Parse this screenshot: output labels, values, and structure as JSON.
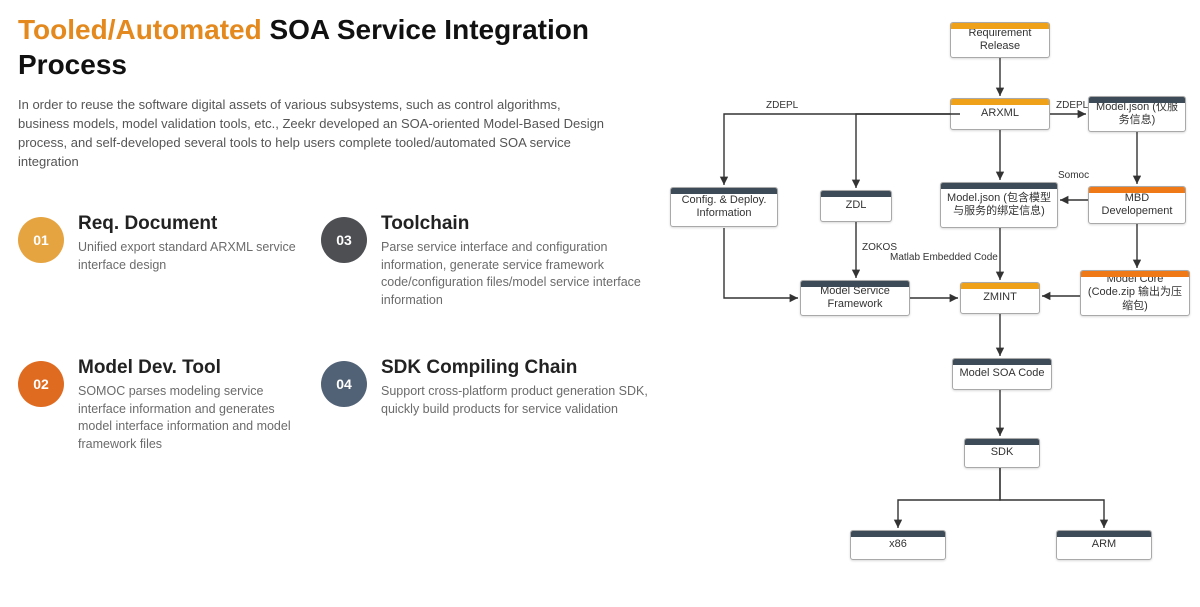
{
  "title": {
    "orange": "Tooled/Automated",
    "black": "SOA Service Integration Process"
  },
  "intro": "In order to reuse the software digital assets of various subsystems, such as control algorithms, business models, model validation tools, etc., Zeekr developed an SOA-oriented Model-Based Design process, and self-developed several tools to help users complete tooled/automated SOA service integration",
  "items": [
    {
      "num": "01",
      "title": "Req. Document",
      "desc": "Unified export standard ARXML service interface design"
    },
    {
      "num": "02",
      "title": "Model Dev. Tool",
      "desc": "SOMOC parses modeling service interface information and generates model interface information and model framework files"
    },
    {
      "num": "03",
      "title": "Toolchain",
      "desc": "Parse service interface and configuration information, generate service framework code/configuration files/model service interface information"
    },
    {
      "num": "04",
      "title": "SDK Compiling Chain",
      "desc": "Support cross-platform product generation SDK, quickly build products for service validation"
    }
  ],
  "nodes": {
    "req": "Requirement Release",
    "arxml": "ARXML",
    "modeljson1": "Model.json (仅服务信息)",
    "config": "Config. & Deploy. Information",
    "zdl": "ZDL",
    "modeljson2": "Model.json (包含模型与服务的绑定信息)",
    "mbd": "MBD Developement",
    "msf": "Model Service Framework",
    "zmint": "ZMINT",
    "modelcore": "Model Core (Code.zip 输出为压缩包)",
    "msoa": "Model SOA Code",
    "sdk": "SDK",
    "x86": "x86",
    "arm": "ARM"
  },
  "labels": {
    "zdepl1": "ZDEPL",
    "zdepl2": "ZDEPL",
    "zokos": "ZOKOS",
    "somoc": "Somoc",
    "matlab": "Matlab Embedded Code"
  }
}
